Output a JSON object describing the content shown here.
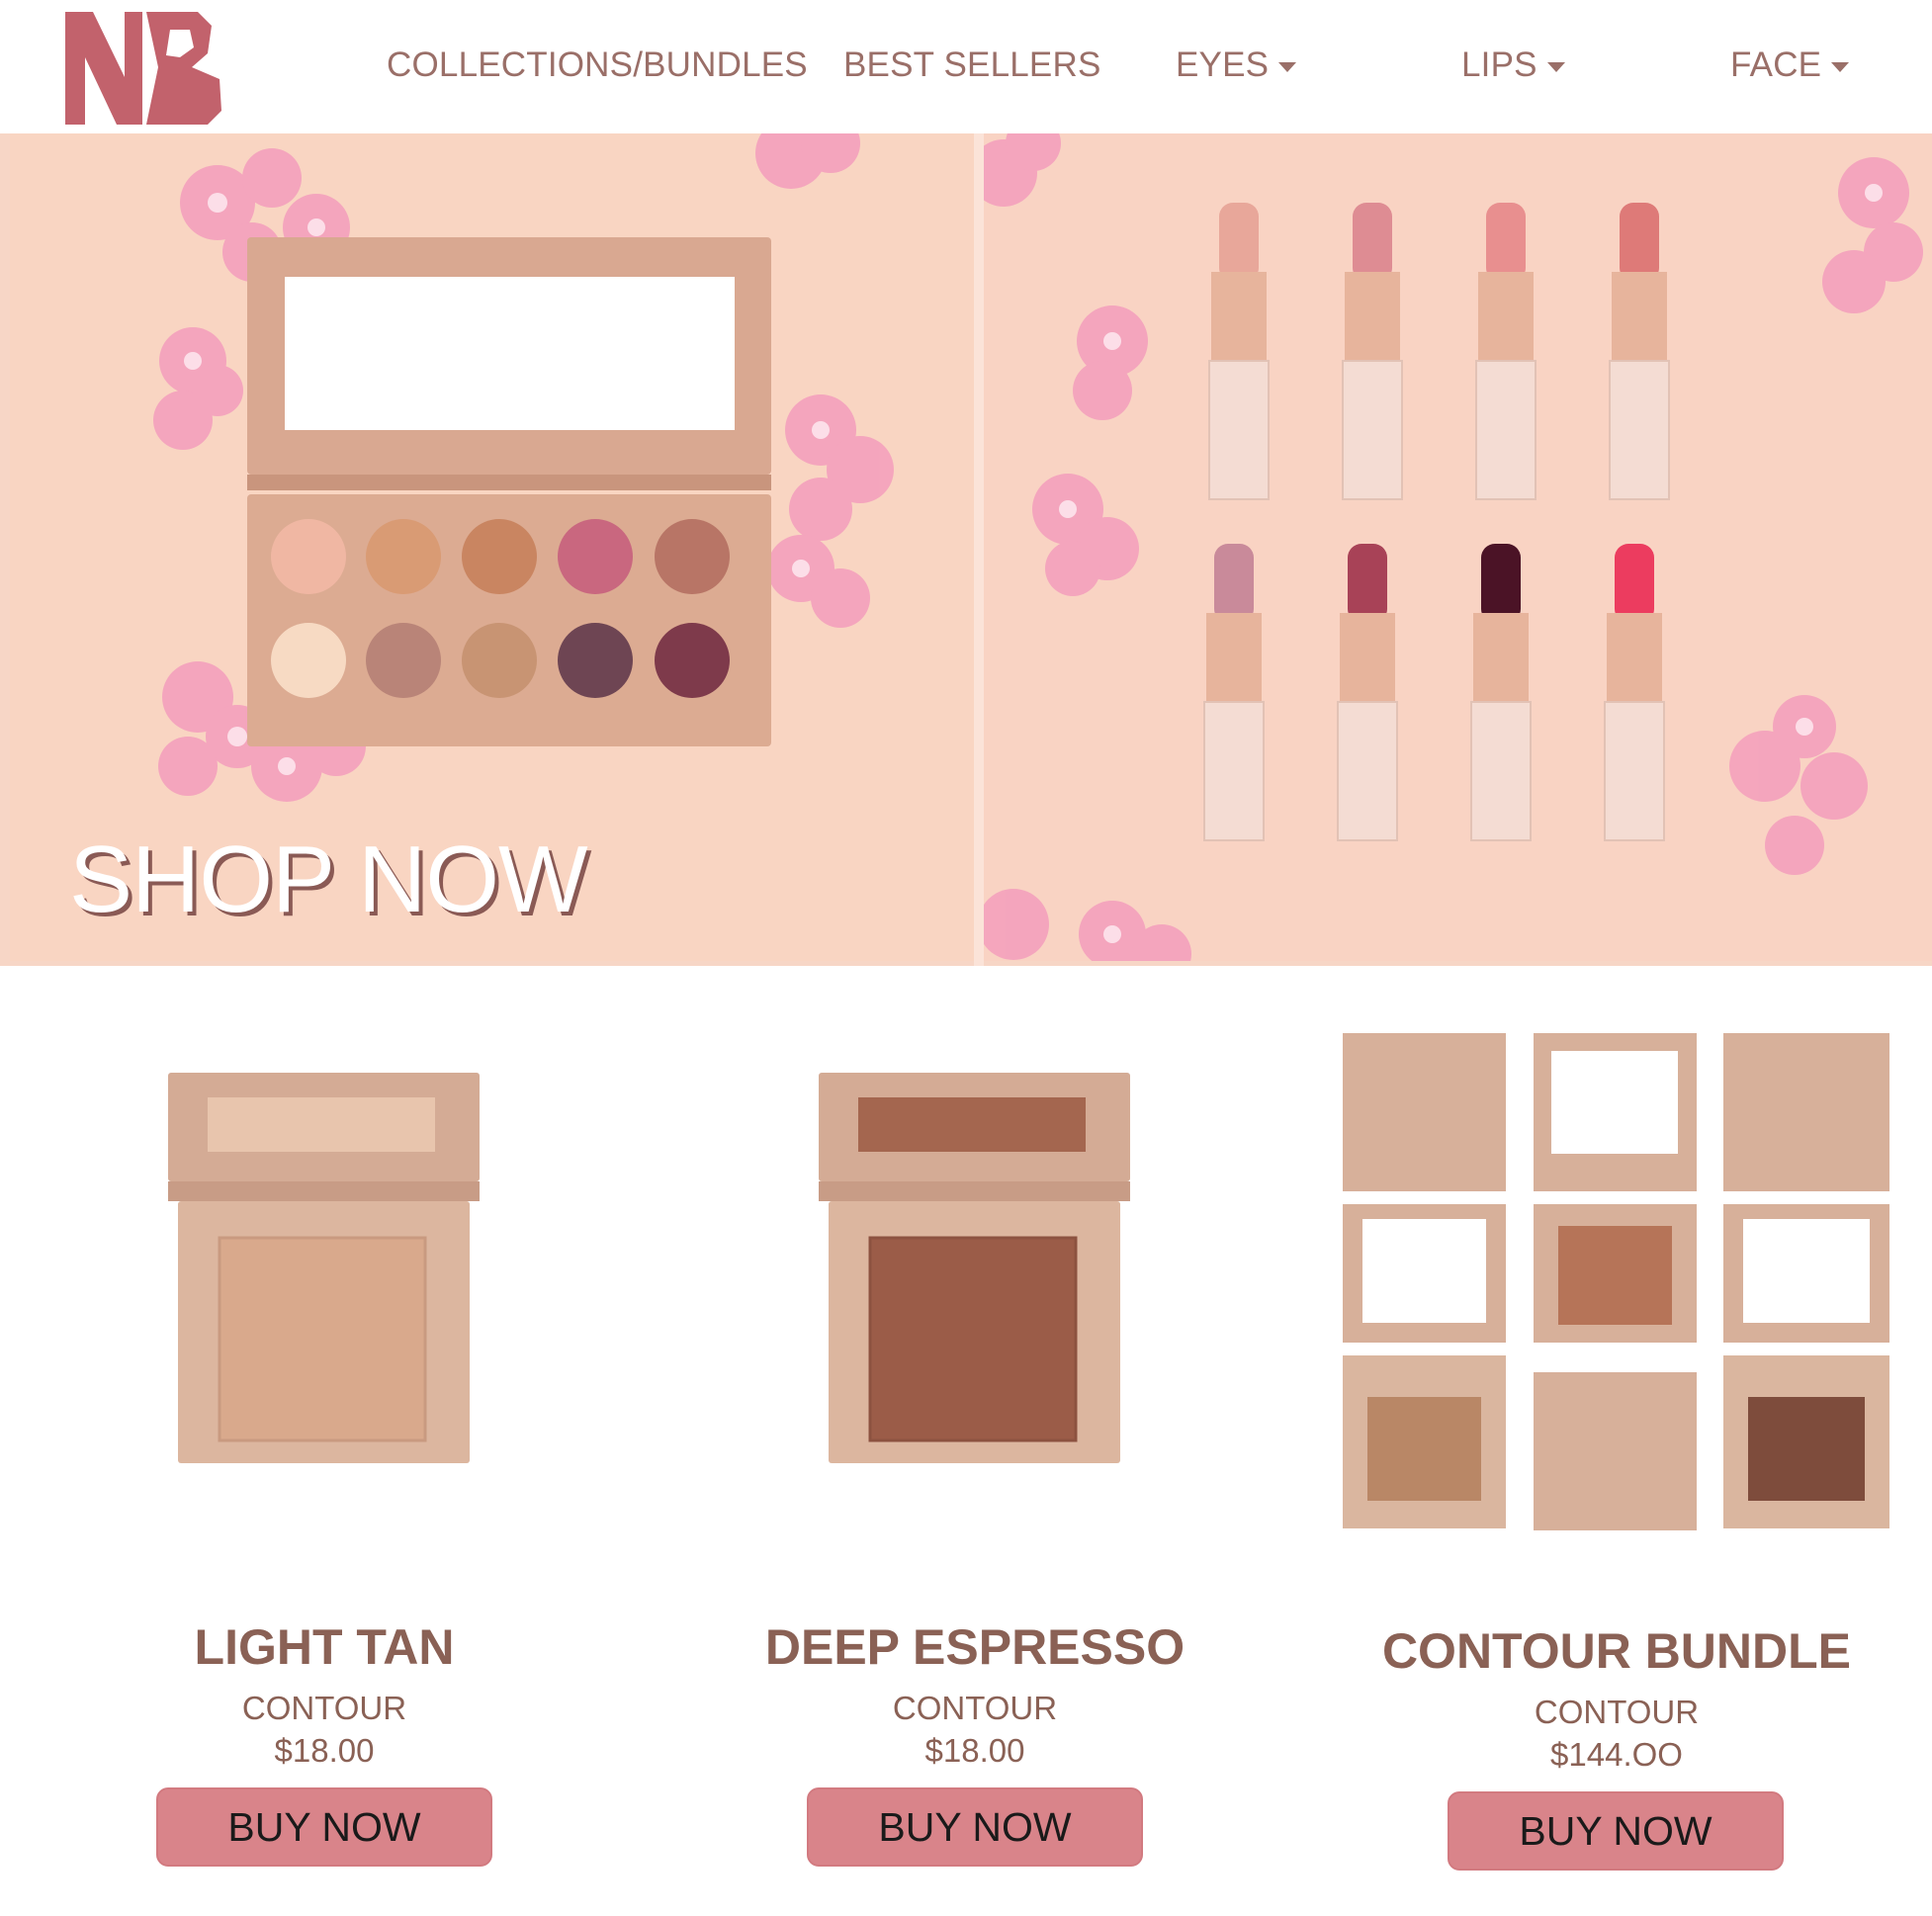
{
  "brand": {
    "logo_text": "NB",
    "logo_color": "#c2626c"
  },
  "nav": {
    "items": [
      {
        "label": "COLLECTIONS/BUNDLES",
        "has_dropdown": false
      },
      {
        "label": "BEST SELLERS",
        "has_dropdown": false
      },
      {
        "label": "EYES",
        "has_dropdown": true
      },
      {
        "label": "LIPS",
        "has_dropdown": true
      },
      {
        "label": "FACE",
        "has_dropdown": true
      }
    ]
  },
  "hero": {
    "cta_label": "SHOP NOW",
    "palette_shades": [
      "#f0b7a3",
      "#d99b74",
      "#c98561",
      "#c9677f",
      "#b87566",
      "#f7dac3",
      "#b98478",
      "#c89473",
      "#6e4553",
      "#7e3a4b"
    ],
    "lipstick_shades_top": [
      "#e8a79a",
      "#de8c93",
      "#e88f8f",
      "#de7a78"
    ],
    "lipstick_shades_bottom": [
      "#c98a9a",
      "#a84257",
      "#4b1326",
      "#ec3c5f"
    ]
  },
  "products": [
    {
      "name": "LIGHT TAN",
      "category": "CONTOUR",
      "price": "$18.00",
      "button": "BUY NOW",
      "swatch": "#d9a98c"
    },
    {
      "name": "DEEP ESPRESSO",
      "category": "CONTOUR",
      "price": "$18.00",
      "button": "BUY NOW",
      "swatch": "#9b5c48"
    },
    {
      "name": "CONTOUR BUNDLE",
      "category": "CONTOUR",
      "price": "$144.OO",
      "button": "BUY NOW",
      "swatch": "#b67458"
    }
  ],
  "colors": {
    "text_brown": "#8a6155",
    "button_bg": "#d9848a",
    "hero_bg": "#f9d5c2",
    "packaging": "#d8b6a0"
  }
}
